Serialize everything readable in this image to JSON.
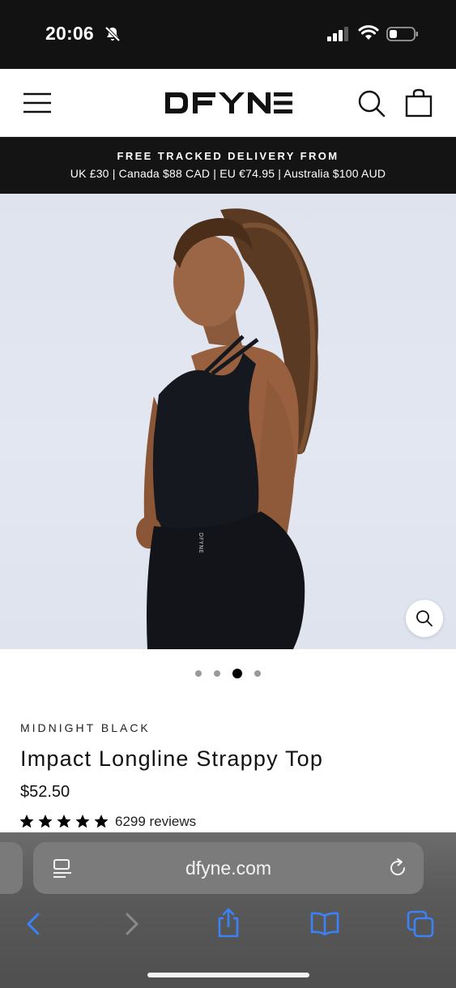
{
  "status_bar": {
    "time": "20:06"
  },
  "header": {
    "logo_text": "DFYNE"
  },
  "announcement": {
    "title": "FREE TRACKED DELIVERY FROM",
    "detail": "UK £30 | Canada $88 CAD | EU €74.95 | Australia $100 AUD"
  },
  "hero": {
    "logo_on_garment": "DFYNE"
  },
  "carousel": {
    "total_slides": 4,
    "active_slide": 3
  },
  "product": {
    "color": "MIDNIGHT BLACK",
    "title": "Impact Longline Strappy Top",
    "price": "$52.50",
    "rating": 5,
    "reviews": "6299 reviews"
  },
  "browser": {
    "url": "dfyne.com"
  },
  "colors": {
    "accent_blue": "#3b82f6",
    "announcement_bg": "#141414"
  }
}
